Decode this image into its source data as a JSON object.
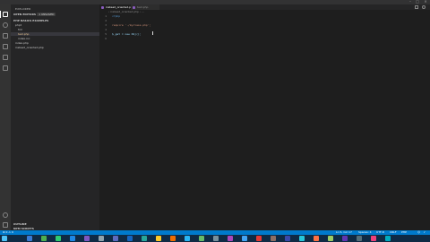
{
  "sidebar": {
    "title": "EXPLORER",
    "open_editors": {
      "label": "OPEN EDITORS",
      "badge": "1 UNSAVED"
    },
    "project": {
      "label": "PHP BASICS EXAMPLES"
    },
    "tree": [
      {
        "label": "phpt",
        "color": "#cccccc"
      },
      {
        "label": "frm",
        "color": "#cccccc"
      },
      {
        "label": "test.php",
        "color": "#e2c08d"
      },
      {
        "label": "index.inc",
        "color": "#cccccc"
      },
      {
        "label": "index.php",
        "color": "#cccccc"
      },
      {
        "label": "instead_oriented.php",
        "color": "#cccccc"
      }
    ],
    "outline": "OUTLINE",
    "npm": "NPM SCRIPTS"
  },
  "editor": {
    "tabs": [
      {
        "label": "instead_oriented.php"
      },
      {
        "label": "test.php"
      }
    ],
    "breadcrumb": "› instead_oriented.php › ...",
    "lines": [
      {
        "num": "1",
        "text": "<?php",
        "color": "#569cd6"
      },
      {
        "num": "2",
        "text": "",
        "color": "#d4d4d4"
      },
      {
        "num": "3",
        "text": "require './myclass.php';",
        "color": "#ce9178"
      },
      {
        "num": "4",
        "text": "",
        "color": "#d4d4d4"
      },
      {
        "num": "5",
        "text": "$_get = new Obj();",
        "color": "#9cdcfe"
      },
      {
        "num": "6",
        "text": "",
        "color": "#d4d4d4"
      }
    ]
  },
  "statusbar": {
    "left": "⊗ 0 ⚠ 0",
    "position": "Ln 5, Col 17",
    "spaces": "Spaces: 4",
    "encoding": "UTF-8",
    "eol": "CRLF",
    "language": "PHP"
  },
  "colors": {
    "accent": "#007acc",
    "taskbar_icons": [
      "#3a7bd5",
      "#4caf50",
      "#2ecc71",
      "#1e88e5",
      "#7e57c2",
      "#90a4ae",
      "#5c6bc0",
      "#1565c0",
      "#26a69a",
      "#ffca28",
      "#ef6c00",
      "#29b6f6",
      "#66bb6a",
      "#78909c",
      "#ab47bc",
      "#42a5f5",
      "#e53935",
      "#8d6e63",
      "#3949ab",
      "#26c6da",
      "#ff7043",
      "#9ccc65",
      "#5e35b1",
      "#546e7a",
      "#ec407a",
      "#00acc1"
    ]
  }
}
